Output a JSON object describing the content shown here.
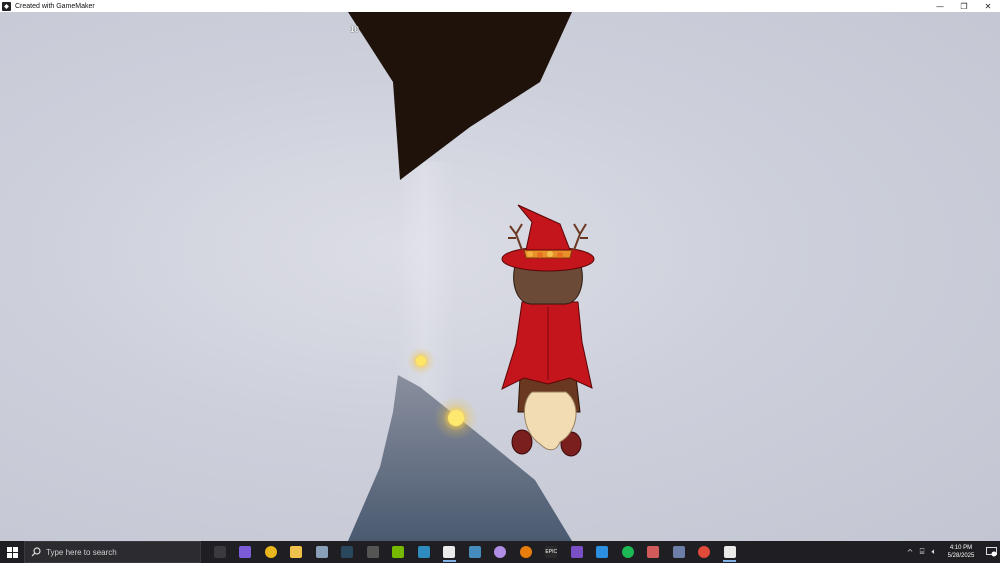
{
  "window": {
    "title": "Created with GameMaker"
  },
  "hud": {
    "score": "10"
  },
  "colors": {
    "rock_top": "#1e120a",
    "rock_bottom": "#4e5b70",
    "orb": "#ffd84a",
    "witch_red": "#c4141c"
  },
  "taskbar": {
    "search_placeholder": "Type here to search",
    "time": "4:10 PM",
    "date": "5/28/2025",
    "apps": [
      {
        "name": "task-view-icon",
        "color": "#3a3a40"
      },
      {
        "name": "news-icon",
        "color": "#7b5cd6"
      },
      {
        "name": "chrome-icon",
        "color": "#e8b71d"
      },
      {
        "name": "file-explorer-icon",
        "color": "#f0c24b"
      },
      {
        "name": "files-icon",
        "color": "#8aa0b8"
      },
      {
        "name": "steam-icon",
        "color": "#2a475e"
      },
      {
        "name": "app-icon",
        "color": "#555"
      },
      {
        "name": "nvidia-icon",
        "color": "#76b900"
      },
      {
        "name": "git-icon",
        "color": "#2e8bc0"
      },
      {
        "name": "gamemaker-icon",
        "color": "#eaeaea"
      },
      {
        "name": "godot-icon",
        "color": "#478cbf"
      },
      {
        "name": "discord-icon",
        "color": "#b08ee8"
      },
      {
        "name": "blender-icon",
        "color": "#e87d0d"
      },
      {
        "name": "epic-icon",
        "color": "#2a2a2a"
      },
      {
        "name": "visual-studio-icon",
        "color": "#7a4fc6"
      },
      {
        "name": "vscode-icon",
        "color": "#2d8fe0"
      },
      {
        "name": "spotify-icon",
        "color": "#1db954"
      },
      {
        "name": "cloud-app-icon",
        "color": "#d35a5a"
      },
      {
        "name": "calculator-icon",
        "color": "#6c7fa8"
      },
      {
        "name": "chrome-alt-icon",
        "color": "#e04a3a"
      },
      {
        "name": "gamemaker-runner-icon",
        "color": "#eaeaea"
      }
    ],
    "tray": {
      "epic_label": "EPIC"
    }
  }
}
